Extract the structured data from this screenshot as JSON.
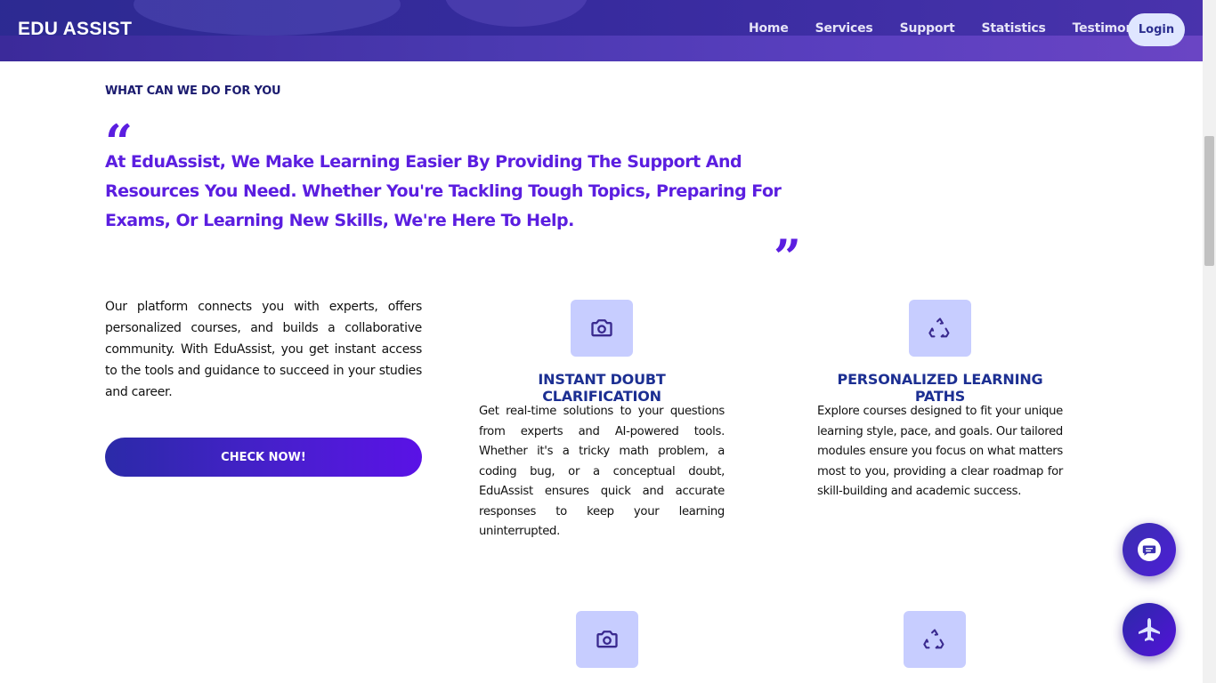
{
  "header": {
    "brand": "EDU ASSIST",
    "nav": [
      "Home",
      "Services",
      "Support",
      "Statistics",
      "Testimonials"
    ],
    "login_label": "Login"
  },
  "section": {
    "label": "WHAT CAN WE DO FOR YOU",
    "quote": "At EduAssist, We Make Learning Easier By Providing The Support And Resources You Need. Whether You're Tackling Tough Topics, Preparing For Exams, Or Learning New Skills, We're Here To Help.",
    "quote_open_glyph": "“",
    "quote_close_glyph": "”",
    "intro": "Our platform connects you with experts, offers personalized courses, and builds a collaborative community. With EduAssist, you get instant access to the tools and guidance to succeed in your studies and career.",
    "cta_label": "CHECK NOW!"
  },
  "features": [
    {
      "icon": "camera-icon",
      "title": "INSTANT DOUBT CLARIFICATION",
      "description": "Get real-time solutions to your questions from experts and AI-powered tools. Whether it's a tricky math problem, a coding bug, or a conceptual doubt, EduAssist ensures quick and accurate responses to keep your learning uninterrupted."
    },
    {
      "icon": "recycle-icon",
      "title": "PERSONALIZED LEARNING PATHS",
      "description": "Explore courses designed to fit your unique learning style, pace, and goals. Our tailored modules ensure you focus on what matters most to you, providing a clear roadmap for skill-building and academic success."
    },
    {
      "icon": "camera-icon"
    },
    {
      "icon": "recycle-icon"
    }
  ],
  "fabs": [
    "chat-icon",
    "plane-icon"
  ],
  "colors": {
    "accent": "#5b1ee0",
    "title_blue": "#1c2f92",
    "icon_bg": "#c7cdff",
    "header_start": "#3b2a9a",
    "header_end": "#6a45c4"
  }
}
